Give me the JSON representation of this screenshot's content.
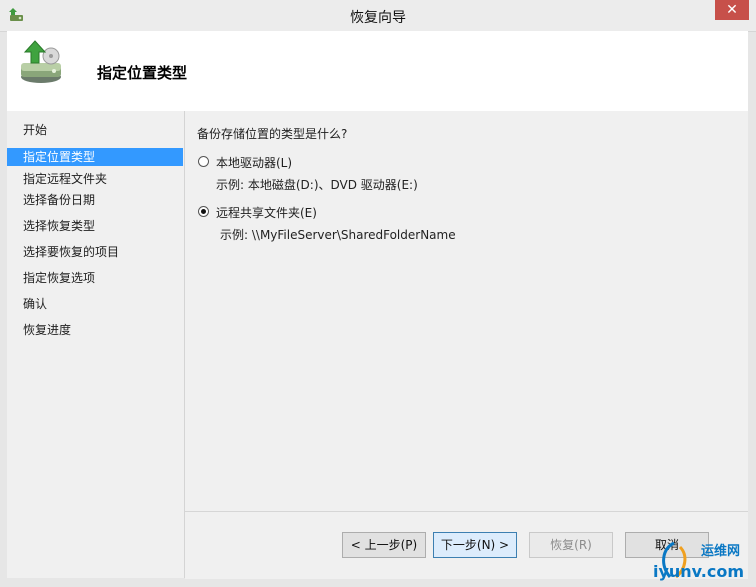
{
  "window": {
    "title": "恢复向导",
    "close_glyph": "✕"
  },
  "header": {
    "title": "指定位置类型"
  },
  "nav": {
    "items": [
      {
        "label": "开始",
        "active": false
      },
      {
        "label": "指定位置类型",
        "active": true
      },
      {
        "label": "指定远程文件夹",
        "active": false
      },
      {
        "label": "选择备份日期",
        "active": false
      },
      {
        "label": "选择恢复类型",
        "active": false
      },
      {
        "label": "选择要恢复的项目",
        "active": false
      },
      {
        "label": "指定恢复选项",
        "active": false
      },
      {
        "label": "确认",
        "active": false
      },
      {
        "label": "恢复进度",
        "active": false
      }
    ]
  },
  "main": {
    "question": "备份存储位置的类型是什么?",
    "options": [
      {
        "label": "本地驱动器(L)",
        "example": "示例: 本地磁盘(D:)、DVD 驱动器(E:)",
        "selected": false
      },
      {
        "label": "远程共享文件夹(E)",
        "example": "示例: \\\\MyFileServer\\SharedFolderName",
        "selected": true
      }
    ]
  },
  "footer": {
    "back_label": "< 上一步(P)",
    "next_label": "下一步(N) >",
    "recover_label": "恢复(R)",
    "cancel_label": "取消"
  },
  "watermark": {
    "line1": "运维网",
    "line2": "iyunv.com"
  }
}
